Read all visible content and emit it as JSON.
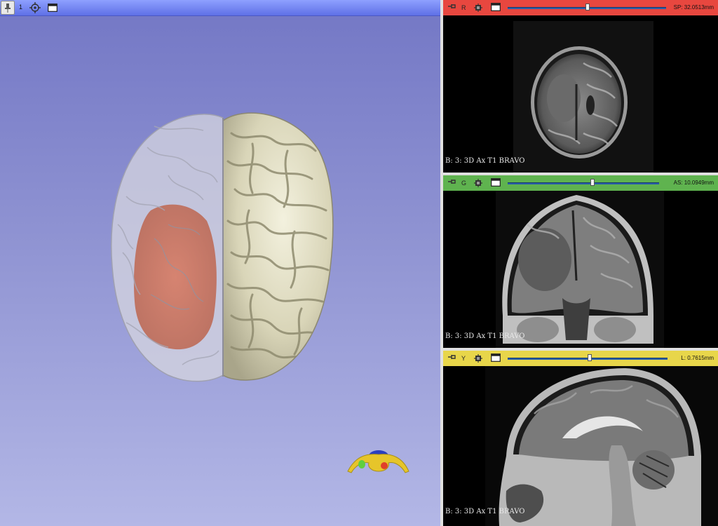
{
  "view3d": {
    "view_number": "1",
    "pin_icon": "pin-icon",
    "center_icon": "center-view-icon",
    "maximize_icon": "maximize-icon",
    "background_top": "#7377c5",
    "background_bottom": "#b3b7e6"
  },
  "slices": [
    {
      "id": "red",
      "letter": "R",
      "color": "#e8473f",
      "offset": "SP: 32.0513mm",
      "slider_fraction": 0.49,
      "label": "B: 3: 3D Ax T1 BRAVO"
    },
    {
      "id": "green",
      "letter": "G",
      "color": "#5fb34f",
      "offset": "AS: 10.0949mm",
      "slider_fraction": 0.5,
      "label": "B: 3: 3D Ax T1 BRAVO"
    },
    {
      "id": "yellow",
      "letter": "Y",
      "color": "#e8d64a",
      "offset": "L: 0.7615mm",
      "slider_fraction": 0.5,
      "label": "B: 3: 3D Ax T1 BRAVO"
    }
  ]
}
